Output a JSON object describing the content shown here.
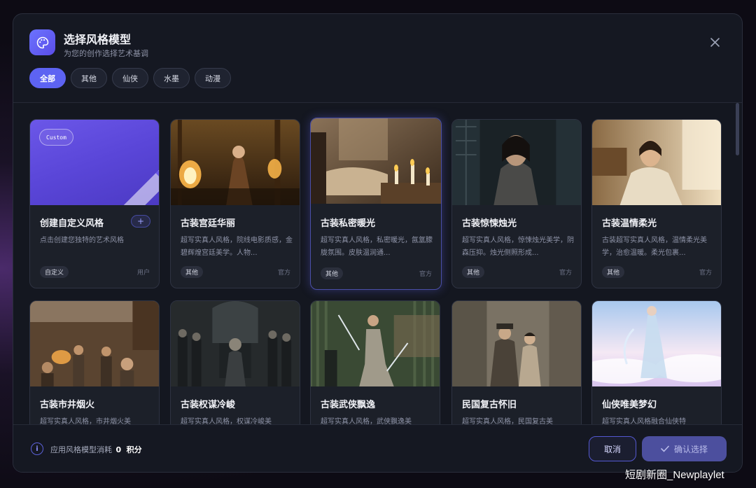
{
  "dialog": {
    "title": "选择风格模型",
    "subtitle": "为您的创作选择艺术基调"
  },
  "filters": [
    "全部",
    "其他",
    "仙侠",
    "水墨",
    "动漫"
  ],
  "custom_card": {
    "badge": "Custom",
    "title": "创建自定义风格",
    "desc": "点击创建您独特的艺术风格",
    "tag": "自定义",
    "source": "用户",
    "plus": "+"
  },
  "cards": [
    {
      "title": "古装宫廷华丽",
      "desc": "超写实真人风格，院线电影质感，金碧辉煌宫廷美学。人物...",
      "tag": "其他",
      "source": "官方"
    },
    {
      "title": "古装私密暖光",
      "desc": "超写实真人风格，私密暖光，氤氲朦胧氛围。皮肤温润通...",
      "tag": "其他",
      "source": "官方"
    },
    {
      "title": "古装惊悚烛光",
      "desc": "超写实真人风格，惊悚烛光美学，阴森压抑。烛光侧照形成...",
      "tag": "其他",
      "source": "官方"
    },
    {
      "title": "古装温情柔光",
      "desc": "古装超写实真人风格，温情柔光美学，治愈温暖。柔光包裹...",
      "tag": "其他",
      "source": "官方"
    },
    {
      "title": "古装市井烟火",
      "desc": "超写实真人风格，市井烟火美"
    },
    {
      "title": "古装权谋冷峻",
      "desc": "超写实真人风格，权谋冷峻美"
    },
    {
      "title": "古装武侠飘逸",
      "desc": "超写实真人风格，武侠飘逸美"
    },
    {
      "title": "民国复古怀旧",
      "desc": "超写实真人风格，民国复古美"
    },
    {
      "title": "仙侠唯美梦幻",
      "desc": "超写实真人风格融合仙侠特"
    }
  ],
  "footer": {
    "cost_prefix": "应用风格模型消耗",
    "cost_value": "0",
    "cost_unit": "积分",
    "cancel": "取消",
    "confirm": "确认选择"
  },
  "watermark": "短剧新圈_Newplaylet",
  "colors": {
    "accent": "#5d63f2",
    "panel": "#151822",
    "card": "#1c2029"
  }
}
